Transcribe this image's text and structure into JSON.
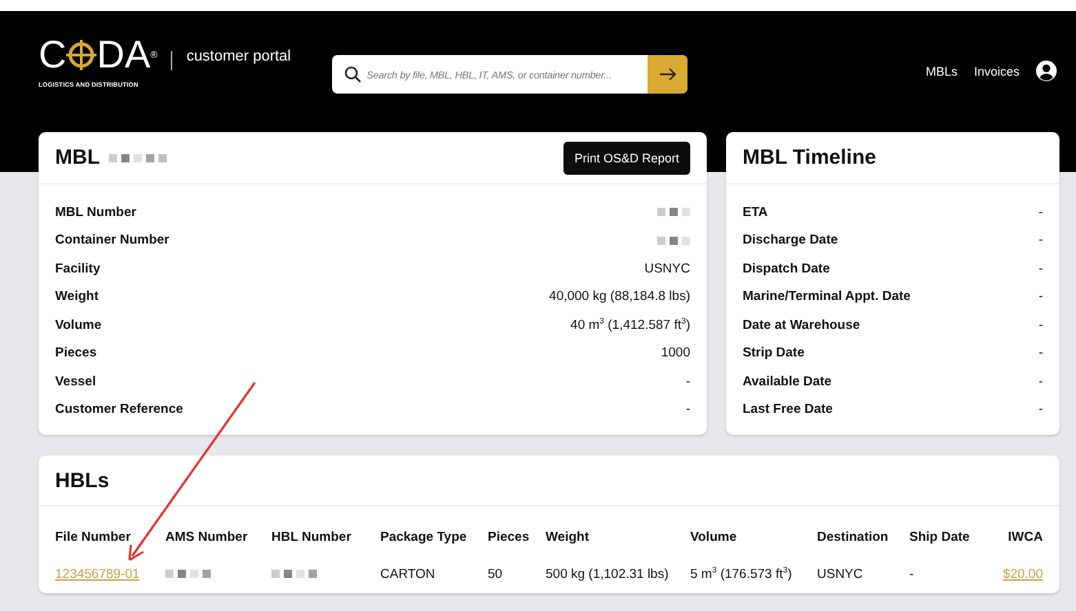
{
  "header": {
    "logo": {
      "left": "C",
      "right": "DA",
      "mark": "®",
      "tagline": "LOGISTICS AND DISTRIBUTION"
    },
    "portal": "customer portal",
    "search": {
      "placeholder": "Search by file, MBL, HBL, IT, AMS, or container number..."
    },
    "nav": [
      "MBLs",
      "Invoices"
    ]
  },
  "mbl_card": {
    "title": "MBL",
    "title_redacted": true,
    "button": "Print OS&D Report",
    "rows": [
      {
        "label": "MBL Number",
        "kind": "redacted"
      },
      {
        "label": "Container Number",
        "kind": "redacted"
      },
      {
        "label": "Facility",
        "kind": "text",
        "value": "USNYC"
      },
      {
        "label": "Weight",
        "kind": "text",
        "value": "40,000 kg  (88,184.8 lbs)"
      },
      {
        "label": "Volume",
        "kind": "text",
        "value": "40 m$^{3}$  (1,412.587 ft$^{3}$)"
      },
      {
        "label": "Pieces",
        "kind": "text",
        "value": "1000"
      },
      {
        "label": "Vessel",
        "kind": "text",
        "value": "-"
      },
      {
        "label": "Customer Reference",
        "kind": "text",
        "value": "-"
      }
    ]
  },
  "timeline_card": {
    "title": "MBL Timeline",
    "rows": [
      {
        "label": "ETA",
        "value": "-"
      },
      {
        "label": "Discharge Date",
        "value": "-"
      },
      {
        "label": "Dispatch Date",
        "value": "-"
      },
      {
        "label": "Marine/Terminal Appt. Date",
        "value": "-"
      },
      {
        "label": "Date at Warehouse",
        "value": "-"
      },
      {
        "label": "Strip Date",
        "value": "-"
      },
      {
        "label": "Available Date",
        "value": "-"
      },
      {
        "label": "Last Free Date",
        "value": "-"
      }
    ]
  },
  "hbls": {
    "title": "HBLs",
    "columns": [
      "File Number",
      "AMS Number",
      "HBL Number",
      "Package Type",
      "Pieces",
      "Weight",
      "Volume",
      "Destination",
      "Ship Date",
      "IWCA"
    ],
    "rows": [
      [
        {
          "kind": "link",
          "text": "123456789-01"
        },
        {
          "kind": "redacted"
        },
        {
          "kind": "redacted"
        },
        {
          "kind": "text",
          "text": "CARTON"
        },
        {
          "kind": "text",
          "text": "50"
        },
        {
          "kind": "text",
          "text": "500 kg  (1,102.31 lbs)"
        },
        {
          "kind": "text",
          "text": "5 m$^{3}$  (176.573 ft$^{3}$)"
        },
        {
          "kind": "text",
          "text": "USNYC"
        },
        {
          "kind": "text",
          "text": "-"
        },
        {
          "kind": "link",
          "text": "$20.00"
        }
      ]
    ]
  },
  "annotations": [
    {
      "kind": "arrow",
      "color": "#e8302c"
    }
  ]
}
